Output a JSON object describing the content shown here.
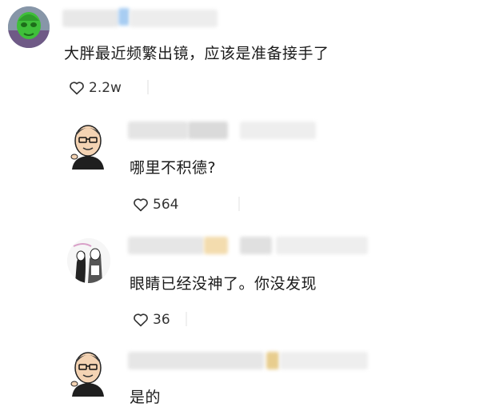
{
  "comments": [
    {
      "avatar": "green-mask-avatar",
      "text": "大胖最近频繁出镜，应该是准备接手了",
      "likes": "2.2w"
    },
    {
      "avatar": "cartoon-bald-man-avatar",
      "text": "哪里不积德?",
      "likes": "564"
    },
    {
      "avatar": "couple-sketch-avatar",
      "text": "眼睛已经没神了。你没发现",
      "likes": "36"
    },
    {
      "avatar": "cartoon-bald-man-avatar",
      "text": "是的"
    }
  ],
  "icons": {
    "like": "heart-outline-icon"
  },
  "colors": {
    "text": "#1a1a1a",
    "like": "#333333",
    "mask_gray": "#e6e6e6",
    "mask_blue": "#cfe3f7",
    "mask_gold": "#f2d9a0"
  }
}
